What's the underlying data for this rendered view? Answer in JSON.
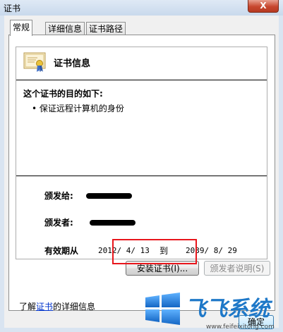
{
  "window": {
    "title": "证书",
    "close_label": "X"
  },
  "tabs": [
    {
      "label": "常规",
      "active": true
    },
    {
      "label": "详细信息",
      "active": false
    },
    {
      "label": "证书路径",
      "active": false
    }
  ],
  "cert": {
    "heading": "证书信息",
    "purpose_heading": "这个证书的目的如下:",
    "purposes": [
      "• 保证远程计算机的身份"
    ],
    "issued_to_label": "颁发给:",
    "issued_by_label": "颁发者:",
    "validity_label": "有效期从",
    "valid_from": "2012/ 4/ 13",
    "to_word": "到",
    "valid_to": "2039/ 8/ 29"
  },
  "buttons": {
    "install": "安装证书(I)...",
    "issuer_statement": "颁发者说明(S)",
    "ok": "确定"
  },
  "learn_more": {
    "prefix": "了解",
    "link": "证书",
    "suffix": "的详细信息"
  },
  "watermark": {
    "brand": "飞飞系统",
    "url": "www.feifeixitong.com"
  },
  "colors": {
    "highlight": "#e8161c",
    "brand_blue": "#1e78c8"
  }
}
